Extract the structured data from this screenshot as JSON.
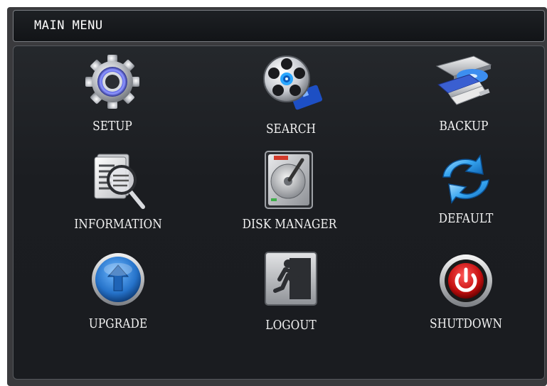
{
  "header": {
    "title": "MAIN MENU"
  },
  "menu": {
    "items": [
      {
        "label": "SETUP",
        "icon": "gear-icon"
      },
      {
        "label": "SEARCH",
        "icon": "film-reel-search-icon"
      },
      {
        "label": "BACKUP",
        "icon": "disc-drive-usb-icon"
      },
      {
        "label": "INFORMATION",
        "icon": "document-magnifier-icon"
      },
      {
        "label": "DISK MANAGER",
        "icon": "hard-disk-icon"
      },
      {
        "label": "DEFAULT",
        "icon": "refresh-arrows-icon"
      },
      {
        "label": "UPGRADE",
        "icon": "upload-arrow-icon"
      },
      {
        "label": "LOGOUT",
        "icon": "exit-running-man-icon"
      },
      {
        "label": "SHUTDOWN",
        "icon": "power-icon"
      }
    ]
  },
  "colors": {
    "background": "#1b1d21",
    "title_bar": "#15181b",
    "text": "#ffffff",
    "accent_blue": "#2f7fd6",
    "shutdown_red": "#d21c1c"
  }
}
